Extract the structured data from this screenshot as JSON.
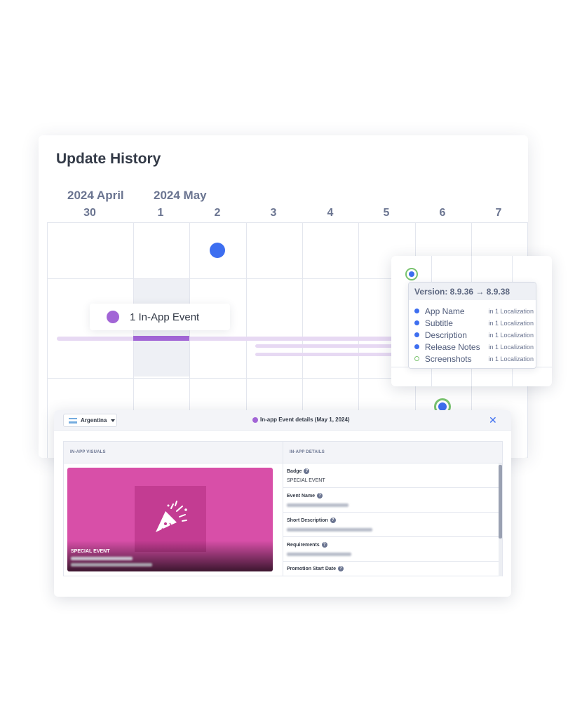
{
  "update_history": {
    "title": "Update History",
    "months": [
      "2024 April",
      "2024 May"
    ],
    "days": [
      "30",
      "1",
      "2",
      "3",
      "4",
      "5",
      "6",
      "7"
    ]
  },
  "event_chip": {
    "label": "1 In-App Event"
  },
  "colors": {
    "event_purple": "#a265d6",
    "update_blue": "#3d6ef0",
    "screenshot_green": "#7ac36f",
    "visual_pink": "#d84fa8"
  },
  "version_tooltip": {
    "title": "Version: 8.9.36 → 8.9.38",
    "rows": [
      {
        "field": "App Name",
        "localization": "in 1 Localization",
        "marker": "filled"
      },
      {
        "field": "Subtitle",
        "localization": "in 1 Localization",
        "marker": "filled"
      },
      {
        "field": "Description",
        "localization": "in 1 Localization",
        "marker": "filled"
      },
      {
        "field": "Release Notes",
        "localization": "in 1 Localization",
        "marker": "filled"
      },
      {
        "field": "Screenshots",
        "localization": "in 1 Localization",
        "marker": "hollow"
      }
    ]
  },
  "event_details": {
    "country": "Argentina",
    "title": "In-app Event details (May 1, 2024)",
    "close_icon": "close-icon",
    "columns": [
      "IN-APP VISUALS",
      "IN-APP DETAILS"
    ],
    "visual_badge": "SPECIAL EVENT",
    "visual_icon": "party-popper-icon",
    "fields": [
      {
        "label": "Badge",
        "value": "SPECIAL EVENT"
      },
      {
        "label": "Event Name",
        "value": ""
      },
      {
        "label": "Short Description",
        "value": ""
      },
      {
        "label": "Requirements",
        "value": ""
      },
      {
        "label": "Promotion Start Date",
        "value": ""
      }
    ]
  }
}
